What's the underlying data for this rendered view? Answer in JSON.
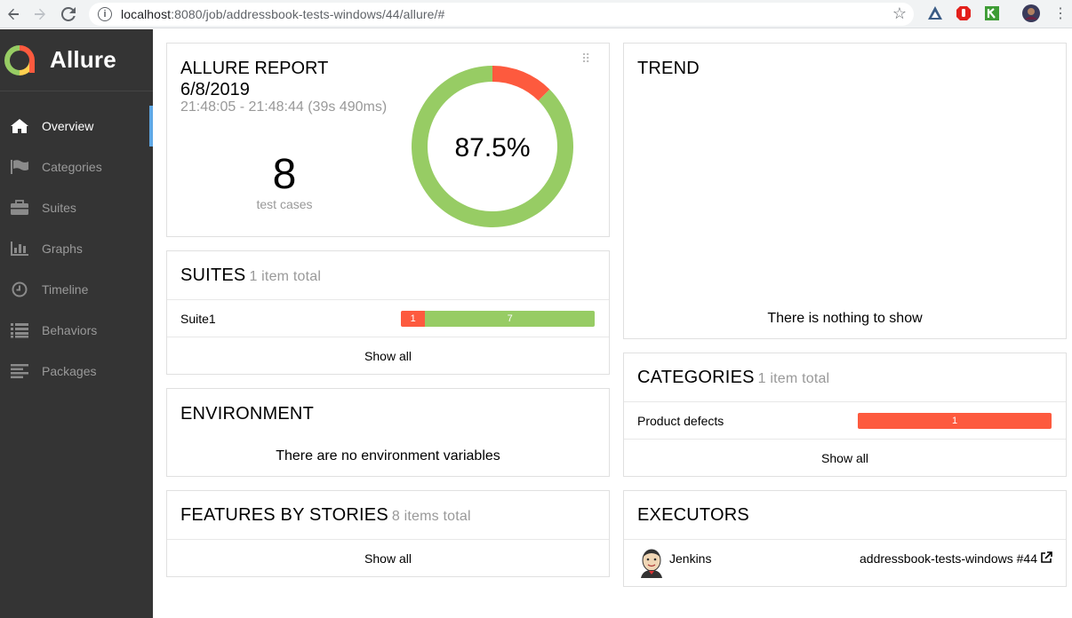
{
  "browser": {
    "url_host": "localhost",
    "url_path": ":8080/job/addressbook-tests-windows/44/allure/#"
  },
  "sidebar": {
    "brand": "Allure",
    "items": [
      {
        "label": "Overview",
        "icon": "home-icon",
        "active": true
      },
      {
        "label": "Categories",
        "icon": "flag-icon",
        "active": false
      },
      {
        "label": "Suites",
        "icon": "briefcase-icon",
        "active": false
      },
      {
        "label": "Graphs",
        "icon": "bar-chart-icon",
        "active": false
      },
      {
        "label": "Timeline",
        "icon": "clock-icon",
        "active": false
      },
      {
        "label": "Behaviors",
        "icon": "list-icon",
        "active": false
      },
      {
        "label": "Packages",
        "icon": "align-left-icon",
        "active": false
      }
    ]
  },
  "summary": {
    "title": "ALLURE REPORT",
    "date": "6/8/2019",
    "time_range": "21:48:05 - 21:48:44 (39s 490ms)",
    "test_count": "8",
    "test_count_label": "test cases",
    "percent": "87.5%",
    "passed_fraction": 0.875,
    "failed_fraction": 0.125,
    "colors": {
      "passed": "#97cc64",
      "failed": "#fd5a3e"
    }
  },
  "suites": {
    "title": "SUITES",
    "count": "1 item total",
    "rows": [
      {
        "name": "Suite1",
        "failed": "1",
        "passed": "7",
        "failed_value": 1,
        "passed_value": 7
      }
    ],
    "show_all": "Show all"
  },
  "environment": {
    "title": "ENVIRONMENT",
    "message": "There are no environment variables"
  },
  "features": {
    "title": "FEATURES BY STORIES",
    "count": "8 items total",
    "show_all": "Show all"
  },
  "trend": {
    "title": "TREND",
    "message": "There is nothing to show"
  },
  "categories": {
    "title": "CATEGORIES",
    "count": "1 item total",
    "rows": [
      {
        "name": "Product defects",
        "value": "1"
      }
    ],
    "show_all": "Show all"
  },
  "executors": {
    "title": "EXECUTORS",
    "name": "Jenkins",
    "build": "addressbook-tests-windows #44"
  }
}
